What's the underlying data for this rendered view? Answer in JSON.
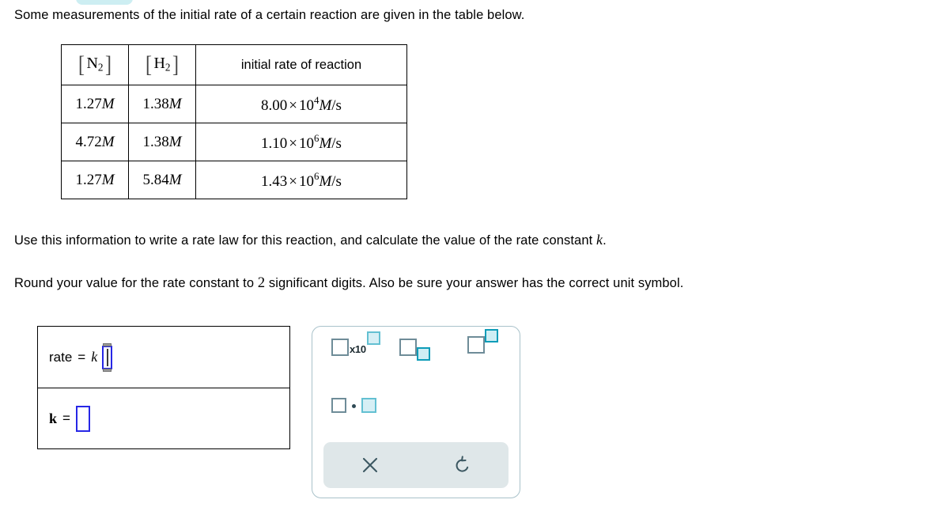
{
  "question": {
    "intro": "Some measurements of the initial rate of a certain reaction are given in the table below.",
    "instruction_1_part1": "Use this information to write a rate law for this reaction, and calculate the value of the rate constant ",
    "instruction_1_var": "k",
    "instruction_1_part2": ".",
    "instruction_2_part1": "Round your value for the rate constant to ",
    "instruction_2_digits": "2",
    "instruction_2_part2": " significant digits. Also be sure your answer has the correct unit symbol."
  },
  "table": {
    "headers": {
      "col1_species": "N",
      "col1_sub": "2",
      "col2_species": "H",
      "col2_sub": "2",
      "col3": "initial rate of reaction"
    },
    "rows": [
      {
        "n2": "1.27",
        "n2_unit": "M",
        "h2": "1.38",
        "h2_unit": "M",
        "rate_mantissa": "8.00",
        "rate_times": "×",
        "rate_base": "10",
        "rate_exp": "4",
        "rate_unit": "M",
        "rate_unit_tail": "/s"
      },
      {
        "n2": "4.72",
        "n2_unit": "M",
        "h2": "1.38",
        "h2_unit": "M",
        "rate_mantissa": "1.10",
        "rate_times": "×",
        "rate_base": "10",
        "rate_exp": "6",
        "rate_unit": "M",
        "rate_unit_tail": "/s"
      },
      {
        "n2": "1.27",
        "n2_unit": "M",
        "h2": "5.84",
        "h2_unit": "M",
        "rate_mantissa": "1.43",
        "rate_times": "×",
        "rate_base": "10",
        "rate_exp": "6",
        "rate_unit": "M",
        "rate_unit_tail": "/s"
      }
    ]
  },
  "answer": {
    "rate_label": "rate",
    "rate_equals": "=",
    "rate_k": "k",
    "rate_value": "",
    "k_label": "k",
    "k_equals": "=",
    "k_value": ""
  },
  "keypad": {
    "sci_notation_label": "x10",
    "buttons": [
      "scientific-notation",
      "subscript",
      "superscript",
      "multiplication-dot"
    ],
    "clear_label": "×",
    "undo_label": "↺"
  },
  "colors": {
    "input_border": "#2727e6",
    "keypad_border": "#a9c2ca",
    "key_gray": "#6e8c98",
    "key_teal": "#0e9cb8",
    "key_teal_fill": "#cfeef4",
    "footer_bg": "#dfe7e9",
    "footer_icon": "#3c5862",
    "top_pill": "#cdeef2"
  }
}
